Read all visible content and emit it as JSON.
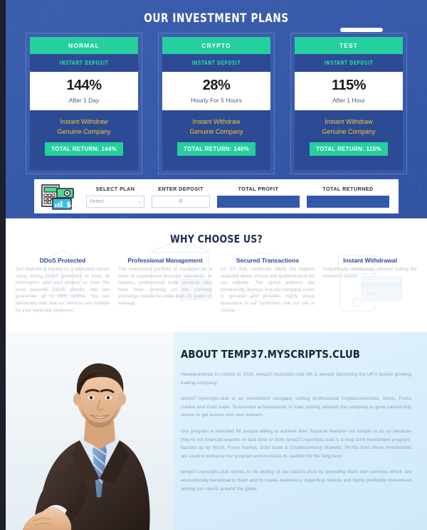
{
  "plans_section": {
    "title": "OUR INVESTMENT PLANS",
    "plans": [
      {
        "name": "NORMAL",
        "deposit_type": "INSTANT DEPOSIT",
        "rate": "144%",
        "period": "After 1 Day",
        "feature1": "Instant Withdraw",
        "feature2": "Genuine Company",
        "total_return": "TOTAL RETURN: 144%"
      },
      {
        "name": "CRYPTO",
        "deposit_type": "INSTANT DEPOSIT",
        "rate": "28%",
        "period": "Hourly For 5 Hours",
        "feature1": "Instant Withdraw",
        "feature2": "Genuine Company",
        "total_return": "TOTAL RETURN: 140%"
      },
      {
        "name": "TEST",
        "deposit_type": "INSTANT DEPOSIT",
        "rate": "115%",
        "period": "After 1 Hour",
        "feature1": "Instant Withdraw",
        "feature2": "Genuine Company",
        "total_return": "TOTAL RETURN: 115%"
      }
    ]
  },
  "calculator": {
    "icon": "calculator-money-icon",
    "select_plan_label": "SELECT PLAN",
    "select_plan_value": "Select",
    "select_chevron": "⌄",
    "enter_deposit_label": "ENTER DEPOSIT",
    "enter_deposit_value": "0",
    "total_profit_label": "TOTAL PROFIT",
    "total_profit_value": "",
    "total_returned_label": "TOTAL RETURNED",
    "total_returned_value": ""
  },
  "why_choose": {
    "title": "WHY CHOOSE US?",
    "columns": [
      {
        "heading": "DDoS Protected",
        "text": "Our Website is hosted on a dedicated server using strong DDoS protection to keep all information safe and protect us from the most powerful DDoS attacks. We can guarantee up to 99% uptime. You can absolutely sure that our services are suitable for your particular purposes."
      },
      {
        "heading": "Professional Management",
        "text": "The investment portfolio is managed by a team of experienced financial specialists, of lawyers, professional trade analysts who have been working on the currency exchange market for more than 10 years on average."
      },
      {
        "heading": "Secured Transactions",
        "text": "An EV SSL certificate offers the highest available levels of trust and authentication for our website. The green address bar prominently displays that our company name is genuine and provides highly visual assurance to our customers that our site is secure."
      },
      {
        "heading": "Instant Withdrawal",
        "text": "Daily/Hourly withdrawals allowed suiting the investor's needs."
      }
    ]
  },
  "about": {
    "photo": "businessman-handshake-photo",
    "title": "ABOUT TEMP37.MYSCRIPTS.CLUB",
    "paragraphs": [
      "Headquartered in London in 2016, temp37.myscripts.club UK is already becoming the UK's fastest growing trading company.",
      "temp37.myscripts.club is an investment company uniting professional Cryptocurrencies, Stock, Forex market and Gold trade. Successful achievements in main activity allowed the company to grow partnership assets to get access into new markets.",
      "Our program is intended for people willing to achieve their financial freedom but unable to do so because they're not financial experts or lack time or both temp37.myscripts.club is a long term investment program, backed up by Stock, Forex market, Gold trade & Cryptocurrency Markets. Profits from these investments are used to enhance our program and increase its stability for the long term.",
      "temp37.myscripts.club strives to be worthy of our client's trust by providing them with services which are economically beneficial to them and to create awareness regarding reliable and highly profitable investment among our clients around the globe."
    ]
  },
  "colors": {
    "hero_blue": "#3458ab",
    "card_blue": "#2d4b95",
    "accent_green": "#26cf9e",
    "accent_gold": "#f2c233",
    "heading_navy": "#1f2f54",
    "about_bg": "#d9eefb"
  }
}
